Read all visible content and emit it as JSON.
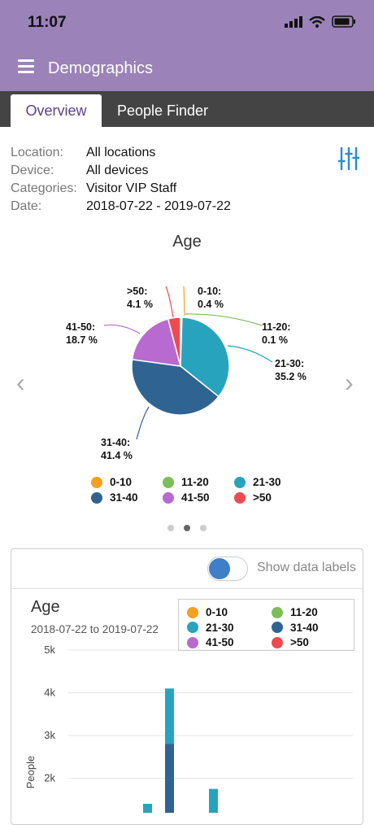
{
  "status": {
    "time": "11:07"
  },
  "app": {
    "title": "Demographics"
  },
  "tabs": [
    {
      "label": "Overview",
      "active": true
    },
    {
      "label": "People Finder",
      "active": false
    }
  ],
  "filters": [
    {
      "label": "Location:",
      "value": "All locations"
    },
    {
      "label": "Device:",
      "value": "All devices"
    },
    {
      "label": "Categories:",
      "value": "Visitor VIP Staff"
    },
    {
      "label": "Date:",
      "value": "2018-07-22 - 2019-07-22"
    }
  ],
  "toggle": {
    "label": "Show data labels",
    "on": true
  },
  "nav": {
    "prev": "‹",
    "next": "›"
  },
  "pager": {
    "count": 3,
    "active": 1
  },
  "colors": {
    "header": "#9b82b9",
    "tab_bar": "#444444",
    "accent": "#5e3f8a"
  },
  "chart_data": [
    {
      "type": "pie",
      "title": "Age",
      "slices": [
        {
          "label": "0-10",
          "value": 0.4,
          "color": "#f5a020",
          "line1": "0-10:",
          "line2": "0.4 %"
        },
        {
          "label": "11-20",
          "value": 0.1,
          "color": "#7dbd5a",
          "line1": "11-20:",
          "line2": "0.1 %"
        },
        {
          "label": "21-30",
          "value": 35.2,
          "color": "#27a3bd",
          "line1": "21-30:",
          "line2": "35.2 %"
        },
        {
          "label": "31-40",
          "value": 41.4,
          "color": "#2f6392",
          "line1": "31-40:",
          "line2": "41.4 %"
        },
        {
          "label": "41-50",
          "value": 18.7,
          "color": "#b86ad0",
          "line1": "41-50:",
          "line2": "18.7 %"
        },
        {
          "label": ">50",
          "value": 4.1,
          "color": "#ee4b4f",
          "line1": ">50:",
          "line2": "4.1 %"
        }
      ]
    },
    {
      "type": "bar",
      "title": "Age",
      "subtitle": "2018-07-22 to 2019-07-22",
      "ylabel": "People",
      "yticks": [
        "5k",
        "4k",
        "3k",
        "2k"
      ],
      "ylim": [
        0,
        5000
      ],
      "legend": [
        "0-10",
        "11-20",
        "21-30",
        "31-40",
        "41-50",
        ">50"
      ],
      "series": [
        {
          "name": "31-40",
          "values": [
            0,
            2800,
            0
          ]
        },
        {
          "name": "21-30",
          "values": [
            0,
            1300,
            0
          ]
        }
      ],
      "extra_bars": [
        {
          "series": "21-30",
          "value": 1400
        },
        {
          "series": "21-30",
          "value": 1750
        }
      ]
    }
  ]
}
